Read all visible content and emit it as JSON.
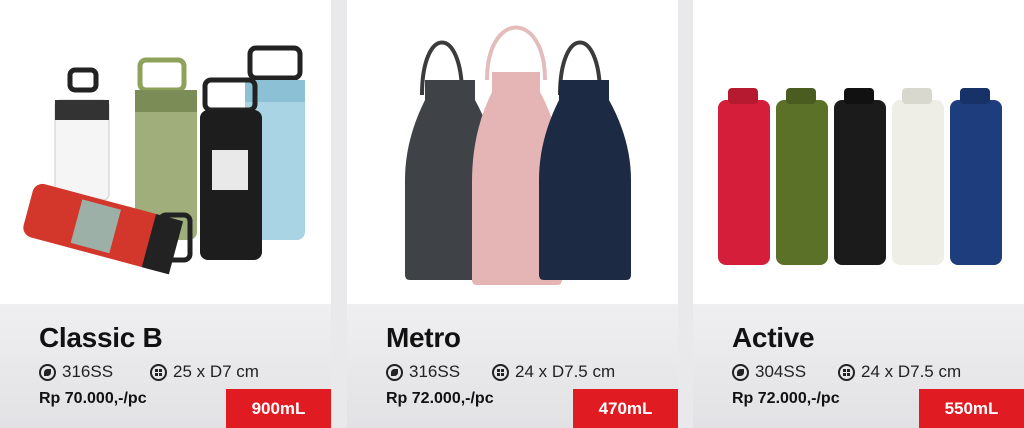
{
  "products": [
    {
      "name": "Classic B",
      "material": "316SS",
      "dimension": "25 x D7 cm",
      "price": "Rp 70.000,-/pc",
      "capacity": "900mL"
    },
    {
      "name": "Metro",
      "material": "316SS",
      "dimension": "24 x D7.5 cm",
      "price": "Rp 72.000,-/pc",
      "capacity": "470mL"
    },
    {
      "name": "Active",
      "material": "304SS",
      "dimension": "24 x D7.5 cm",
      "price": "Rp 72.000,-/pc",
      "capacity": "550mL"
    }
  ],
  "colors": {
    "accent": "#e11b22"
  }
}
